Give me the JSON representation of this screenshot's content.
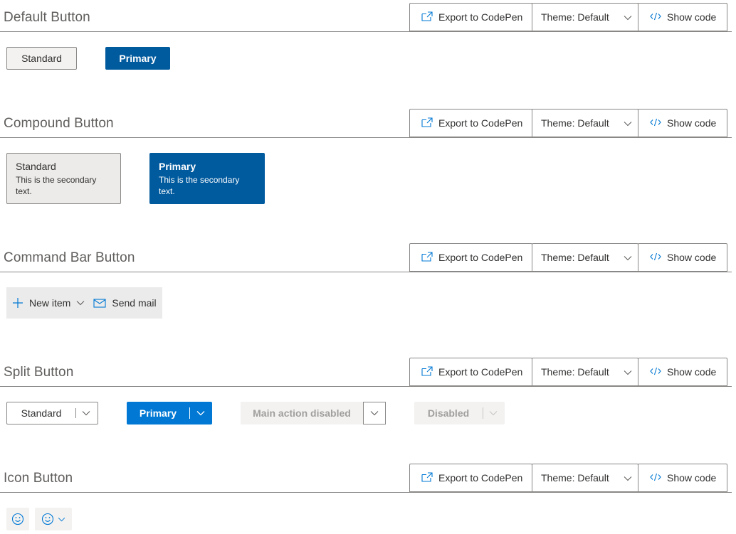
{
  "toolbar": {
    "export_label": "Export to CodePen",
    "theme_label": "Theme: Default",
    "show_code_label": "Show code"
  },
  "sections": {
    "default_button": {
      "title": "Default Button",
      "standard_label": "Standard",
      "primary_label": "Primary"
    },
    "compound_button": {
      "title": "Compound Button",
      "standard_label": "Standard",
      "standard_secondary": "This is the secondary text.",
      "primary_label": "Primary",
      "primary_secondary": "This is the secondary text."
    },
    "command_bar_button": {
      "title": "Command Bar Button",
      "new_item_label": "New item",
      "send_mail_label": "Send mail"
    },
    "split_button": {
      "title": "Split Button",
      "standard_label": "Standard",
      "primary_label": "Primary",
      "main_action_disabled_label": "Main action disabled",
      "disabled_label": "Disabled"
    },
    "icon_button": {
      "title": "Icon Button"
    }
  },
  "colors": {
    "primary": "#005a9e",
    "primary_bright": "#0078d4",
    "accent_icon": "#0078d4",
    "neutral_bg": "#f3f2f1",
    "disabled_text": "#a19f9d"
  },
  "icons": {
    "export": "share-external-icon",
    "chevron": "chevron-down-icon",
    "code": "code-icon",
    "add": "plus-icon",
    "mail": "mail-icon",
    "emoji": "smiley-icon"
  }
}
